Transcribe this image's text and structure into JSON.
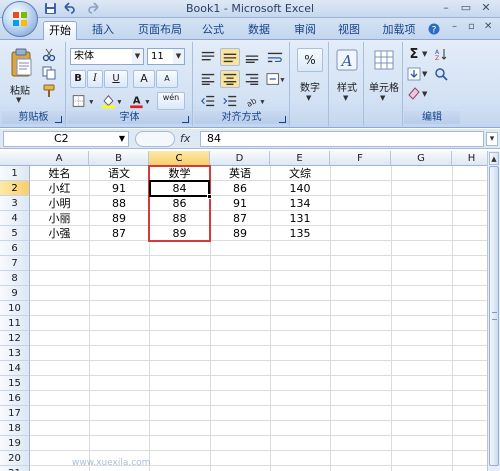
{
  "window": {
    "title": "Book1 - Microsoft Excel",
    "controls": [
      "–",
      "▭",
      "✕"
    ]
  },
  "quick_access": [
    "save-icon",
    "undo-icon",
    "redo-icon"
  ],
  "tabs": [
    {
      "label": "开始",
      "active": true
    },
    {
      "label": "插入"
    },
    {
      "label": "页面布局"
    },
    {
      "label": "公式"
    },
    {
      "label": "数据"
    },
    {
      "label": "审阅"
    },
    {
      "label": "视图"
    },
    {
      "label": "加载项"
    }
  ],
  "ribbon": {
    "clipboard": {
      "paste_label": "粘贴",
      "group_label": "剪贴板"
    },
    "font": {
      "font_name": "宋体",
      "font_size": "11",
      "bold": "B",
      "italic": "I",
      "underline": "U",
      "grow": "A",
      "shrink": "A",
      "phonetic": "wén",
      "group_label": "字体"
    },
    "alignment": {
      "group_label": "对齐方式"
    },
    "number": {
      "label": "数字",
      "percent": "%"
    },
    "styles": {
      "label": "样式"
    },
    "cells": {
      "label": "单元格"
    },
    "editing": {
      "group_label": "编辑"
    }
  },
  "formula_bar": {
    "name_box": "C2",
    "fx": "fx",
    "value": "84"
  },
  "columns": [
    "A",
    "B",
    "C",
    "D",
    "E",
    "F",
    "G",
    "H"
  ],
  "selected_column": "C",
  "rows": [
    "1",
    "2",
    "3",
    "4",
    "5",
    "6",
    "7",
    "8",
    "9",
    "10",
    "11",
    "12",
    "13",
    "14",
    "15",
    "16",
    "17",
    "18",
    "19",
    "20",
    "21"
  ],
  "table": {
    "header": [
      "姓名",
      "语文",
      "数学",
      "英语",
      "文综"
    ],
    "body": [
      [
        "小红",
        "91",
        "84",
        "86",
        "140"
      ],
      [
        "小明",
        "88",
        "86",
        "91",
        "134"
      ],
      [
        "小丽",
        "89",
        "88",
        "87",
        "131"
      ],
      [
        "小强",
        "87",
        "89",
        "89",
        "135"
      ]
    ]
  },
  "selection": {
    "range": "C1:C5",
    "active_cell": "C2",
    "border_color": "#d43a3a"
  },
  "watermark": "www.xuexila.com"
}
